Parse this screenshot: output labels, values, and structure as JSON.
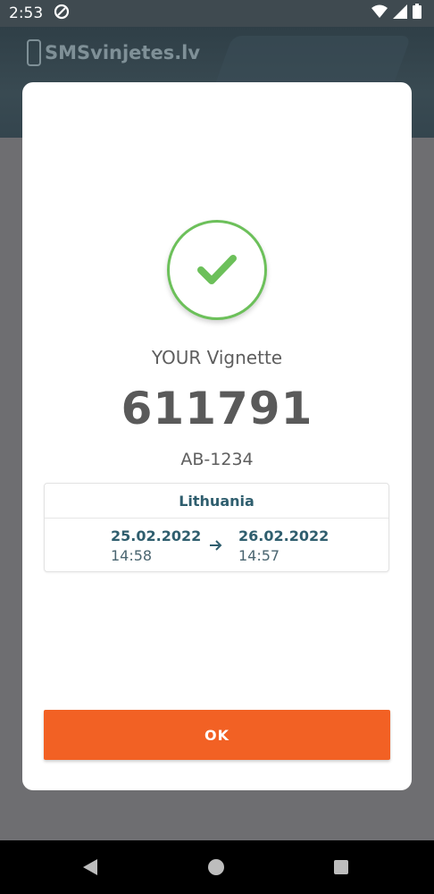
{
  "status_bar": {
    "time": "2:53"
  },
  "app": {
    "logo_text": "SMSvinjetes.lv"
  },
  "dialog": {
    "label": "YOUR Vignette",
    "vignette_number": "611791",
    "plate": "AB-1234",
    "country": "Lithuania",
    "valid_from": {
      "date": "25.02.2022",
      "time": "14:58"
    },
    "valid_to": {
      "date": "26.02.2022",
      "time": "14:57"
    },
    "ok_label": "OK"
  },
  "colors": {
    "accent": "#f26124",
    "success": "#6cc05a",
    "text_primary": "#2f5e6e"
  }
}
